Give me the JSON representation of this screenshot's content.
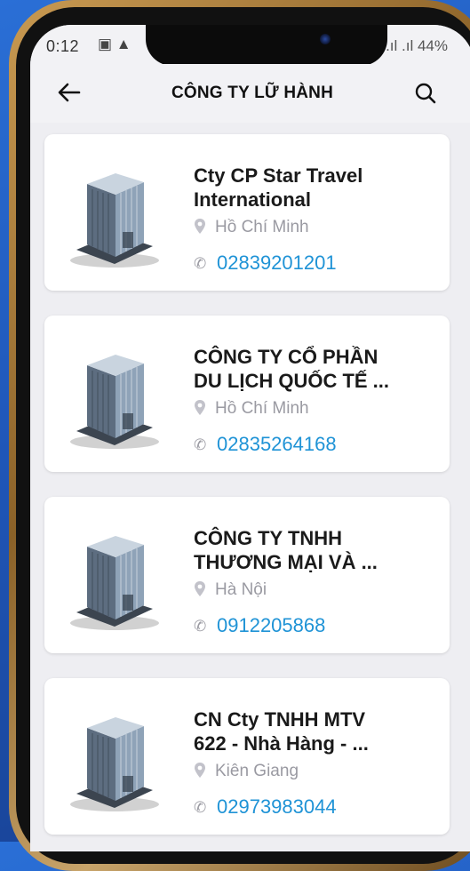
{
  "status": {
    "time": "0:12",
    "left_icons": "▣ ▲",
    "battery": "44%"
  },
  "appbar": {
    "title": "CÔNG TY LỮ HÀNH"
  },
  "companies": [
    {
      "name": "Cty CP Star Travel\nInternational",
      "location": "Hồ Chí Minh",
      "phone": "02839201201"
    },
    {
      "name": "CÔNG TY CỔ PHẦN\nDU LỊCH QUỐC TẾ ...",
      "location": "Hồ Chí Minh",
      "phone": "02835264168"
    },
    {
      "name": "CÔNG TY TNHH\nTHƯƠNG MẠI VÀ ...",
      "location": "Hà Nội",
      "phone": "0912205868"
    },
    {
      "name": "CN Cty TNHH MTV\n622 - Nhà Hàng - ...",
      "location": "Kiên Giang",
      "phone": "02973983044"
    }
  ],
  "colors": {
    "phone_link": "#1f93d6",
    "background": "#2a6fd6"
  },
  "icons": [
    "back-arrow-icon",
    "search-icon",
    "location-pin-icon",
    "phone-icon",
    "building-icon"
  ]
}
